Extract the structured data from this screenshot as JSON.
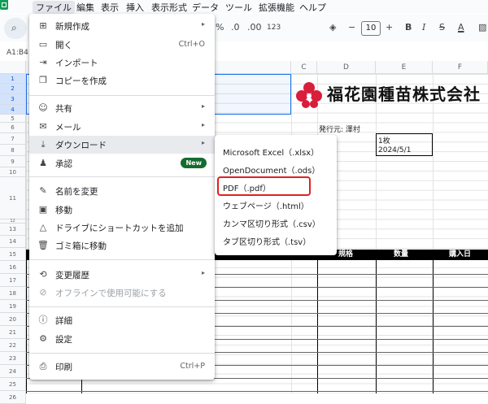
{
  "menubar": {
    "items": [
      "ファイル",
      "編集",
      "表示",
      "挿入",
      "表示形式",
      "データ",
      "ツール",
      "拡張機能",
      "ヘルプ"
    ]
  },
  "toolbar": {
    "search_icon": "search-icon",
    "percent": "%",
    "dec_decrease": ".0",
    "dec_increase": ".00",
    "number_format": "123",
    "font_size": "10",
    "minus": "−",
    "plus": "+",
    "bold": "B",
    "italic": "I",
    "strike": "S",
    "text_color": "A"
  },
  "namebox": {
    "value": "A1:B4"
  },
  "columns": [
    "C",
    "D",
    "E",
    "F"
  ],
  "rows": [
    "1",
    "2",
    "3",
    "4",
    "5",
    "6",
    "7",
    "8",
    "9",
    "10",
    "11",
    "12",
    "13",
    "14",
    "15",
    "16",
    "17",
    "18",
    "19",
    "20",
    "21",
    "22",
    "23",
    "24",
    "25",
    "26"
  ],
  "sheet": {
    "company_name": "福花園種苗株式会社",
    "issuer": "発行元: 澤村",
    "qty": "1枚",
    "date": "2024/5/1",
    "header_spec": "規格",
    "header_qty": "数量",
    "header_date": "購入日"
  },
  "file_menu": {
    "items": [
      {
        "icon": "plus-box-icon",
        "label": "新規作成",
        "arrow": "▸"
      },
      {
        "icon": "folder-icon",
        "label": "開く",
        "shortcut": "Ctrl+O"
      },
      {
        "icon": "import-icon",
        "label": "インポート"
      },
      {
        "icon": "copy-icon",
        "label": "コピーを作成"
      },
      {
        "icon": "share-person-icon",
        "label": "共有",
        "arrow": "▸"
      },
      {
        "icon": "email-icon",
        "label": "メール",
        "arrow": "▸"
      },
      {
        "icon": "download-icon",
        "label": "ダウンロード",
        "arrow": "▸"
      },
      {
        "icon": "approval-icon",
        "label": "承認",
        "badge": "New"
      },
      {
        "icon": "rename-icon",
        "label": "名前を変更"
      },
      {
        "icon": "move-icon",
        "label": "移動"
      },
      {
        "icon": "drive-shortcut-icon",
        "label": "ドライブにショートカットを追加"
      },
      {
        "icon": "trash-icon",
        "label": "ゴミ箱に移動"
      },
      {
        "icon": "history-icon",
        "label": "変更履歴",
        "arrow": "▸"
      },
      {
        "icon": "offline-icon",
        "label": "オフラインで使用可能にする"
      },
      {
        "icon": "info-icon",
        "label": "詳細"
      },
      {
        "icon": "settings-icon",
        "label": "設定"
      },
      {
        "icon": "print-icon",
        "label": "印刷",
        "shortcut": "Ctrl+P"
      }
    ]
  },
  "download_submenu": {
    "items": [
      "Microsoft Excel（.xlsx）",
      "OpenDocument（.ods）",
      "PDF（.pdf）",
      "ウェブページ（.html）",
      "カンマ区切り形式（.csv）",
      "タブ区切り形式（.tsv）"
    ]
  },
  "colors": {
    "accent_red": "#e02020",
    "badge_green": "#146c2e",
    "logo_red": "#d81e3a"
  }
}
